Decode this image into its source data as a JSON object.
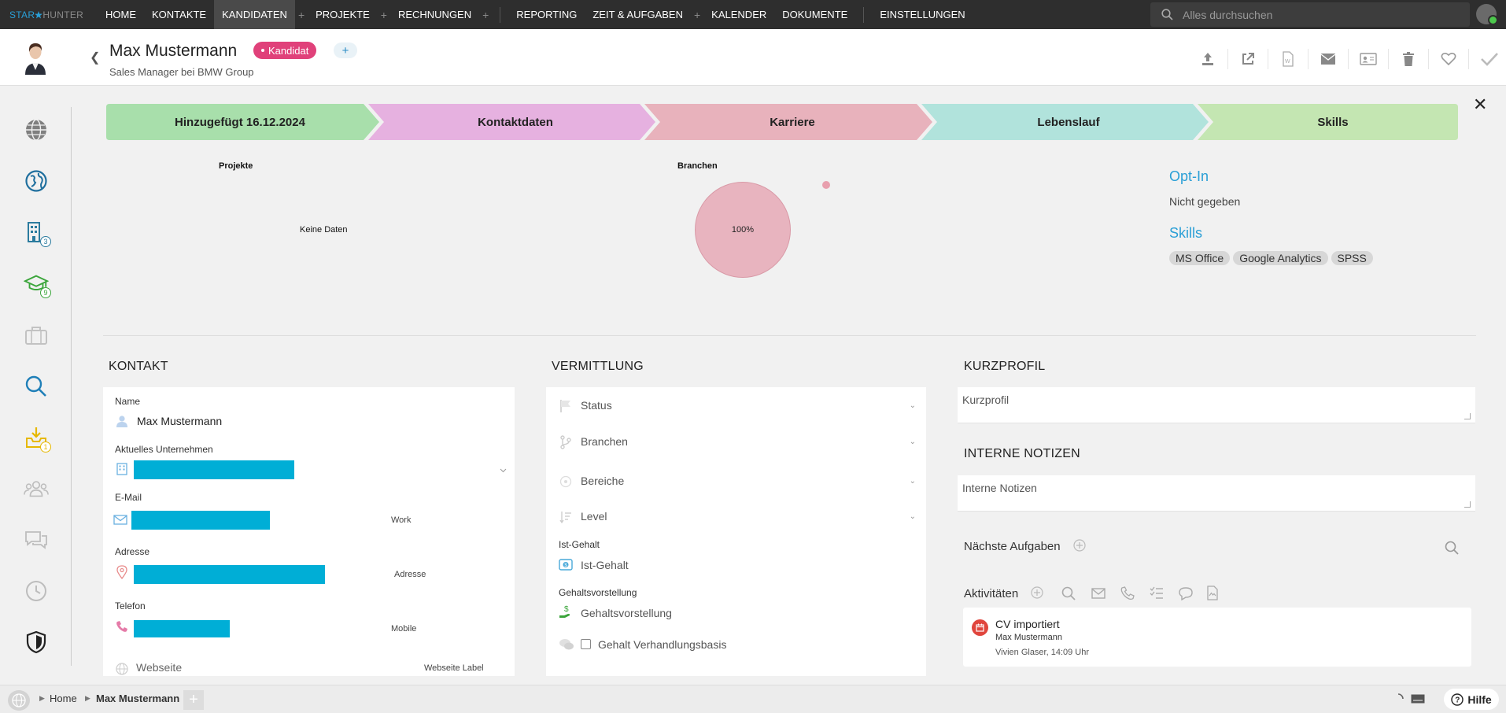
{
  "app": {
    "logo_part1": "STAR",
    "logo_part2": "HUNTER"
  },
  "nav": {
    "items": [
      "HOME",
      "KONTAKTE",
      "KANDIDATEN",
      "PROJEKTE",
      "RECHNUNGEN",
      "REPORTING",
      "ZEIT & AUFGABEN",
      "KALENDER",
      "DOKUMENTE",
      "EINSTELLUNGEN"
    ],
    "active": "KANDIDATEN",
    "search_placeholder": "Alles durchsuchen"
  },
  "header": {
    "name": "Max Mustermann",
    "badge": "Kandidat",
    "add_label": "+",
    "subtitle": "Sales Manager bei BMW Group",
    "actions": [
      "upload-icon",
      "external-link-icon",
      "word-export-icon",
      "mail-icon",
      "contact-card-icon",
      "trash-icon",
      "heart-icon",
      "check-icon"
    ]
  },
  "sidebar": {
    "items": [
      {
        "icon": "globe-icon"
      },
      {
        "icon": "world-icon"
      },
      {
        "icon": "building-icon",
        "count": "3"
      },
      {
        "icon": "graduation-cap-icon",
        "count": "9"
      },
      {
        "icon": "briefcase-icon"
      },
      {
        "icon": "search-icon"
      },
      {
        "icon": "download-tray-icon",
        "count": "1"
      },
      {
        "icon": "people-icon"
      },
      {
        "icon": "chat-icon"
      },
      {
        "icon": "clock-icon"
      },
      {
        "icon": "shield-icon"
      }
    ]
  },
  "steps": [
    {
      "label": "Hinzugefügt 16.12.2024",
      "color": "#a8dfab"
    },
    {
      "label": "Kontaktdaten",
      "color": "#e6b1e0"
    },
    {
      "label": "Karriere",
      "color": "#e8b2bc"
    },
    {
      "label": "Lebenslauf",
      "color": "#b1e3dc"
    },
    {
      "label": "Skills",
      "color": "#c4e6b2"
    }
  ],
  "chart_data": [
    {
      "type": "bar",
      "title": "Projekte",
      "no_data": "Keine Daten"
    },
    {
      "type": "pie",
      "title": "Branchen",
      "slices": [
        {
          "value": 100,
          "label": "100%",
          "color": "#e8b4bf"
        }
      ]
    }
  ],
  "optin": {
    "title": "Opt-In",
    "value": "Nicht gegeben"
  },
  "skills": {
    "title": "Skills",
    "chips": [
      "MS Office",
      "Google Analytics",
      "SPSS"
    ]
  },
  "kontakt": {
    "title": "KONTAKT",
    "name_label": "Name",
    "name_value": "Max Mustermann",
    "company_label": "Aktuelles Unternehmen",
    "email_label": "E-Mail",
    "email_type": "Work",
    "address_label": "Adresse",
    "address_type": "Adresse",
    "phone_label": "Telefon",
    "phone_type": "Mobile",
    "website_placeholder": "Webseite",
    "website_label": "Webseite Label"
  },
  "vermittlung": {
    "title": "VERMITTLUNG",
    "dropdowns": [
      "Status",
      "Branchen",
      "Bereiche",
      "Level"
    ],
    "ist_label": "Ist-Gehalt",
    "ist_placeholder": "Ist-Gehalt",
    "wunsch_label": "Gehaltsvorstellung",
    "wunsch_placeholder": "Gehaltsvorstellung",
    "verhandlung": "Gehalt Verhandlungsbasis"
  },
  "kurzprofil": {
    "title": "KURZPROFIL",
    "placeholder": "Kurzprofil"
  },
  "notizen": {
    "title": "INTERNE NOTIZEN",
    "placeholder": "Interne Notizen"
  },
  "aufgaben": {
    "title": "Nächste Aufgaben"
  },
  "aktivitaeten": {
    "title": "Aktivitäten",
    "entry": {
      "title": "CV importiert",
      "person": "Max Mustermann",
      "meta": "Vivien Glaser, 14:09 Uhr"
    }
  },
  "footer": {
    "crumbs": [
      "Home",
      "Max Mustermann"
    ],
    "help": "Hilfe"
  }
}
